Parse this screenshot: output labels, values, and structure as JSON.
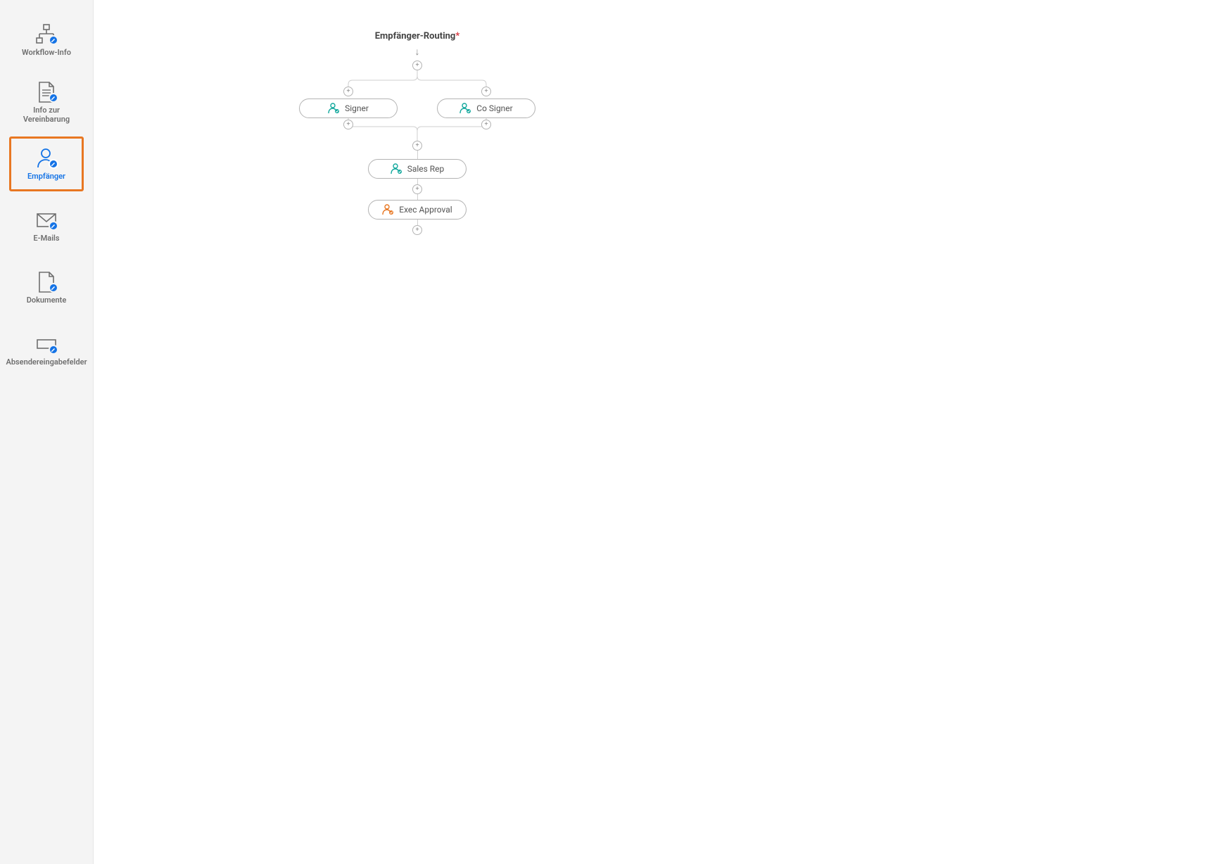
{
  "sidebar": {
    "items": [
      {
        "label": "Workflow-Info"
      },
      {
        "label": "Info zur Vereinbarung"
      },
      {
        "label": "Empfänger"
      },
      {
        "label": "E-Mails"
      },
      {
        "label": "Dokumente"
      },
      {
        "label": "Absendereingabefelder"
      }
    ],
    "active_index": 2
  },
  "routing": {
    "title": "Empfänger-Routing",
    "required_mark": "*",
    "recipients": {
      "signer": "Signer",
      "co_signer": "Co Signer",
      "sales_rep": "Sales Rep",
      "exec_approval": "Exec Approval"
    }
  },
  "icons": {
    "plus": "+",
    "edit_badge": "pencil"
  },
  "colors": {
    "accent_orange": "#e87722",
    "accent_blue": "#1473e6",
    "teal": "#12a89d",
    "pill_orange": "#e87722"
  }
}
